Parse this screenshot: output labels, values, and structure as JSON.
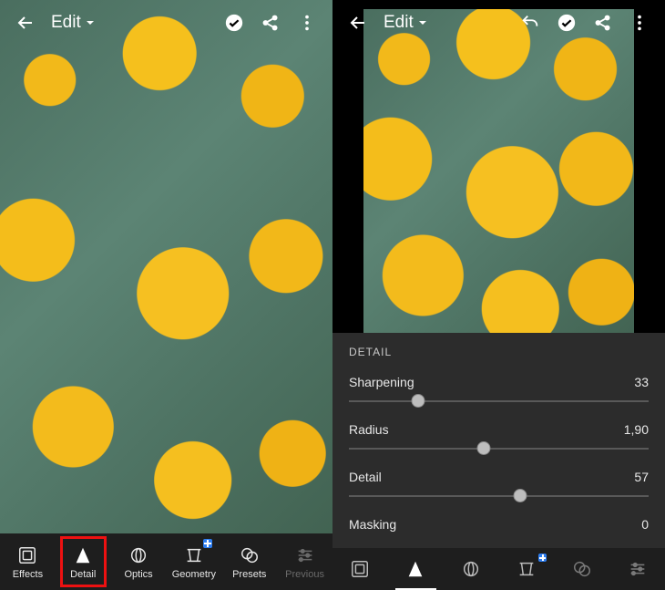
{
  "left": {
    "title": "Edit",
    "tabs": [
      {
        "label": "Effects"
      },
      {
        "label": "Detail"
      },
      {
        "label": "Optics"
      },
      {
        "label": "Geometry"
      },
      {
        "label": "Presets"
      },
      {
        "label": "Previous"
      }
    ]
  },
  "right": {
    "title": "Edit",
    "panel_title": "DETAIL",
    "sliders": {
      "sharpening": {
        "label": "Sharpening",
        "value": "33",
        "pct": 23
      },
      "radius": {
        "label": "Radius",
        "value": "1,90",
        "pct": 45
      },
      "detail": {
        "label": "Detail",
        "value": "57",
        "pct": 57
      },
      "masking": {
        "label": "Masking",
        "value": "0",
        "pct": 0
      }
    }
  }
}
